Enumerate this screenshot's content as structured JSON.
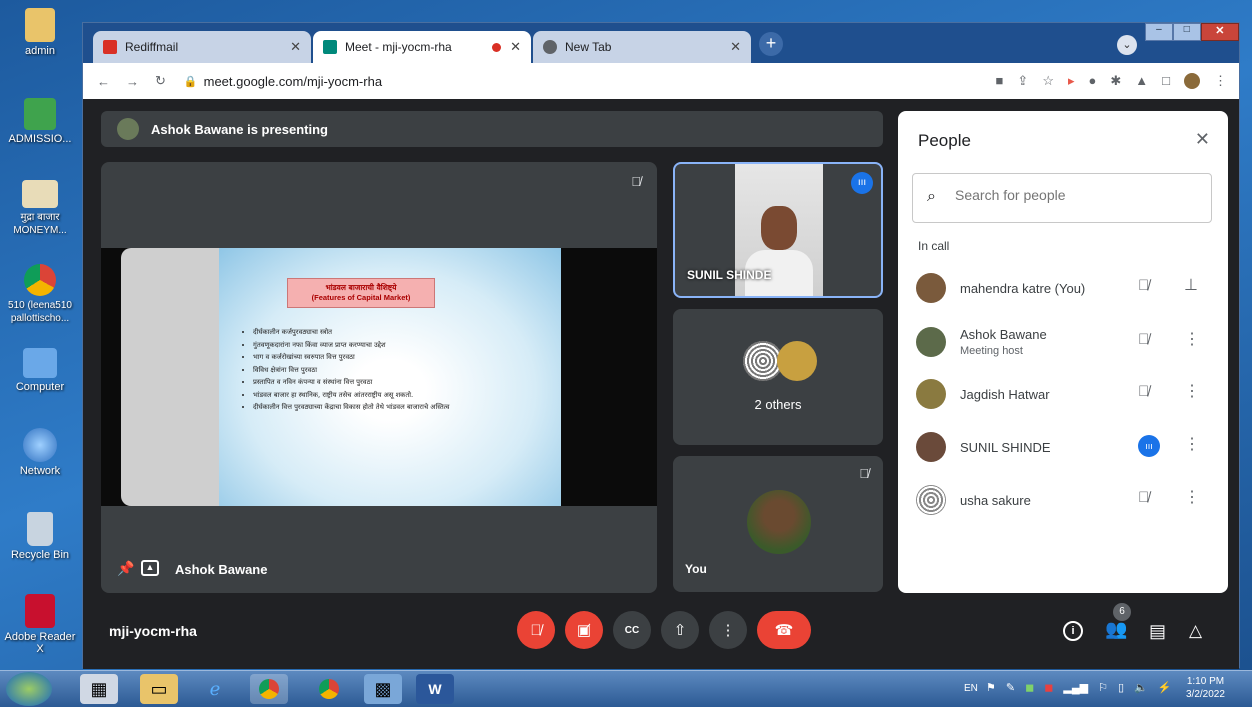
{
  "desktop": {
    "icons": [
      {
        "label": "admin",
        "icon": "folder-icon",
        "color": "#e9c46a"
      },
      {
        "label": "ADMISSIO...",
        "icon": "spreadsheet-icon",
        "color": "#3fa34d"
      },
      {
        "label": "मुद्रा बाजार MONEYM...",
        "icon": "document-icon",
        "color": "#e8dcb8"
      },
      {
        "label": "510 (leena510 pallottischo...",
        "icon": "chrome-icon",
        "color": "#db4437"
      },
      {
        "label": "Computer",
        "icon": "computer-icon",
        "color": "#6aa8e8"
      },
      {
        "label": "Network",
        "icon": "network-icon",
        "color": "#5aa0e0"
      },
      {
        "label": "Recycle Bin",
        "icon": "recycle-bin-icon",
        "color": "#c8d4e0"
      },
      {
        "label": "Adobe Reader X",
        "icon": "pdf-icon",
        "color": "#c8102e"
      }
    ]
  },
  "browser": {
    "tabs": [
      {
        "title": "Rediffmail",
        "active": false,
        "icon": "rediffmail-icon",
        "color": "#d93025"
      },
      {
        "title": "Meet - mji-yocm-rha",
        "active": true,
        "icon": "meet-icon",
        "color": "#00897b"
      },
      {
        "title": "New Tab",
        "active": false,
        "icon": "chrome-icon",
        "color": "#5f6368"
      }
    ],
    "url": "meet.google.com/mji-yocm-rha"
  },
  "meet": {
    "presenting_banner": "Ashok Bawane is presenting",
    "presenter_name": "Ashok Bawane",
    "slide": {
      "title": "भांडवल बाजाराची वैशिष्ट्ये",
      "subtitle": "(Features of Capital Market)",
      "bullets": [
        "दीर्घकालीन कर्जपुरवठ्याचा स्त्रोत",
        "गुंतवणूकदारांना नफा किंवा व्याज प्राप्त करण्याचा उद्देश",
        "भाग व कर्जरोखांच्या स्वरुपात वित्त पुरवठा",
        "विविध क्षेत्रांना वित्त पुरवठा",
        "प्रस्तापित व नविन कंपन्या व संस्थांना वित्त पुरवठा",
        "भांडवल बाजार हा स्थानिक, राष्ट्रीय तसेच आंतरराष्ट्रीय असू शकतो.",
        "दीर्घकालीन वित्त पुरवठ्याच्या केंद्राचा विकास होतो तेथे भांडवल बाजाराचे अस्तित्व"
      ]
    },
    "tiles": {
      "speaker_name": "SUNIL SHINDE",
      "others_label": "2 others",
      "self_label": "You"
    },
    "meeting_code": "mji-yocm-rha",
    "participant_count": "6"
  },
  "people_panel": {
    "title": "People",
    "search_placeholder": "Search for people",
    "section_label": "In call",
    "participants": [
      {
        "name": "mahendra katre (You)",
        "role": "",
        "avatar_color": "#7a5a3c"
      },
      {
        "name": "Ashok Bawane",
        "role": "Meeting host",
        "avatar_color": "#5c6a4a"
      },
      {
        "name": "Jagdish Hatwar",
        "role": "",
        "avatar_color": "#8a7a40"
      },
      {
        "name": "SUNIL SHINDE",
        "role": "",
        "avatar_color": "#6a4a3a"
      },
      {
        "name": "usha sakure",
        "role": "",
        "avatar_color": "#bdbdbd"
      }
    ]
  },
  "taskbar": {
    "language": "EN",
    "time": "1:10 PM",
    "date": "3/2/2022"
  },
  "colors": {
    "meet_bg": "#202124",
    "tile_bg": "#3c4043",
    "danger": "#ea4335",
    "accent": "#1a73e8"
  }
}
